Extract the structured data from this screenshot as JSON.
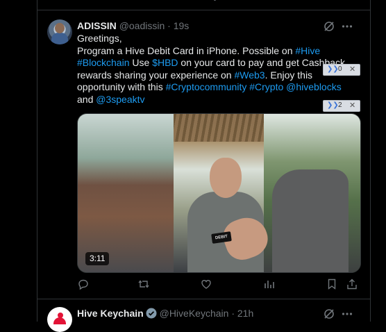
{
  "tweet": {
    "display_name": "ADISSIN",
    "handle": "@oadissin",
    "separator": "·",
    "time": "19s",
    "lines": [
      [
        {
          "t": "Greetings,"
        }
      ],
      [
        {
          "t": "Program a Hive Debit Card in iPhone. Possible on "
        },
        {
          "t": "#Hive",
          "link": true
        }
      ],
      [
        {
          "t": "#Blockchain",
          "link": true
        },
        {
          "t": " Use "
        },
        {
          "t": "$HBD",
          "link": true
        },
        {
          "t": " on your card to pay and get Cashback"
        }
      ],
      [
        {
          "t": "rewards sharing your experience on "
        },
        {
          "t": "#Web3",
          "link": true
        },
        {
          "t": ". Enjoy this"
        }
      ],
      [
        {
          "t": "opportunity with this "
        },
        {
          "t": "#Cryptocommunity",
          "link": true
        },
        {
          "t": " "
        },
        {
          "t": "#Crypto",
          "link": true
        },
        {
          "t": " "
        },
        {
          "t": "@hiveblocks",
          "link": true
        }
      ],
      [
        {
          "t": "and "
        },
        {
          "t": "@3speaktv",
          "link": true
        }
      ]
    ],
    "media": {
      "duration": "3:11",
      "card_text": "DEBIT"
    },
    "icons": {
      "grok": "grok-icon",
      "more": "more-icon",
      "reply": "reply-icon",
      "retweet": "retweet-icon",
      "like": "heart-icon",
      "views": "views-icon",
      "bookmark": "bookmark-icon",
      "share": "share-icon"
    }
  },
  "overlays": [
    {
      "count": "0",
      "close": "✕"
    },
    {
      "count": "2",
      "close": "✕"
    }
  ],
  "next_tweet": {
    "display_name": "Hive Keychain",
    "handle": "@HiveKeychain",
    "separator": "·",
    "time": "21h"
  },
  "colors": {
    "link": "#1d9bf0",
    "verified": "#829aab",
    "background": "#000000"
  }
}
